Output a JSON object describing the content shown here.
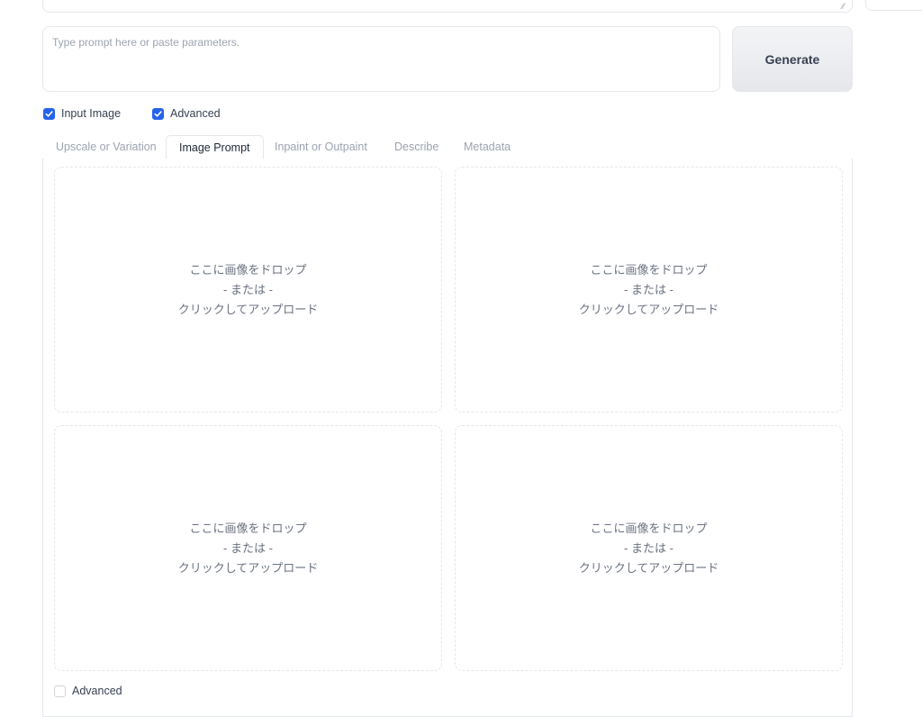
{
  "prompt": {
    "placeholder": "Type prompt here or paste parameters.",
    "value": ""
  },
  "generate": {
    "label": "Generate"
  },
  "options": {
    "input_image": {
      "label": "Input Image",
      "checked": true
    },
    "advanced": {
      "label": "Advanced",
      "checked": true
    }
  },
  "tabs": [
    {
      "label": "Upscale or Variation",
      "active": false
    },
    {
      "label": "Image Prompt",
      "active": true
    },
    {
      "label": "Inpaint or Outpaint",
      "active": false
    },
    {
      "label": "Describe",
      "active": false
    },
    {
      "label": "Metadata",
      "active": false
    }
  ],
  "dropzones": [
    {
      "line1": "ここに画像をドロップ",
      "line2": "- または -",
      "line3": "クリックしてアップロード"
    },
    {
      "line1": "ここに画像をドロップ",
      "line2": "- または -",
      "line3": "クリックしてアップロード"
    },
    {
      "line1": "ここに画像をドロップ",
      "line2": "- または -",
      "line3": "クリックしてアップロード"
    },
    {
      "line1": "ここに画像をドロップ",
      "line2": "- または -",
      "line3": "クリックしてアップロード"
    }
  ],
  "bottom_advanced": {
    "label": "Advanced",
    "checked": false
  },
  "colors": {
    "accent": "#2563eb",
    "border": "#e5e7eb",
    "muted_text": "#9ca3af"
  },
  "icons": {
    "checkbox_checked": "check-icon",
    "resize": "resize-handle-icon"
  }
}
